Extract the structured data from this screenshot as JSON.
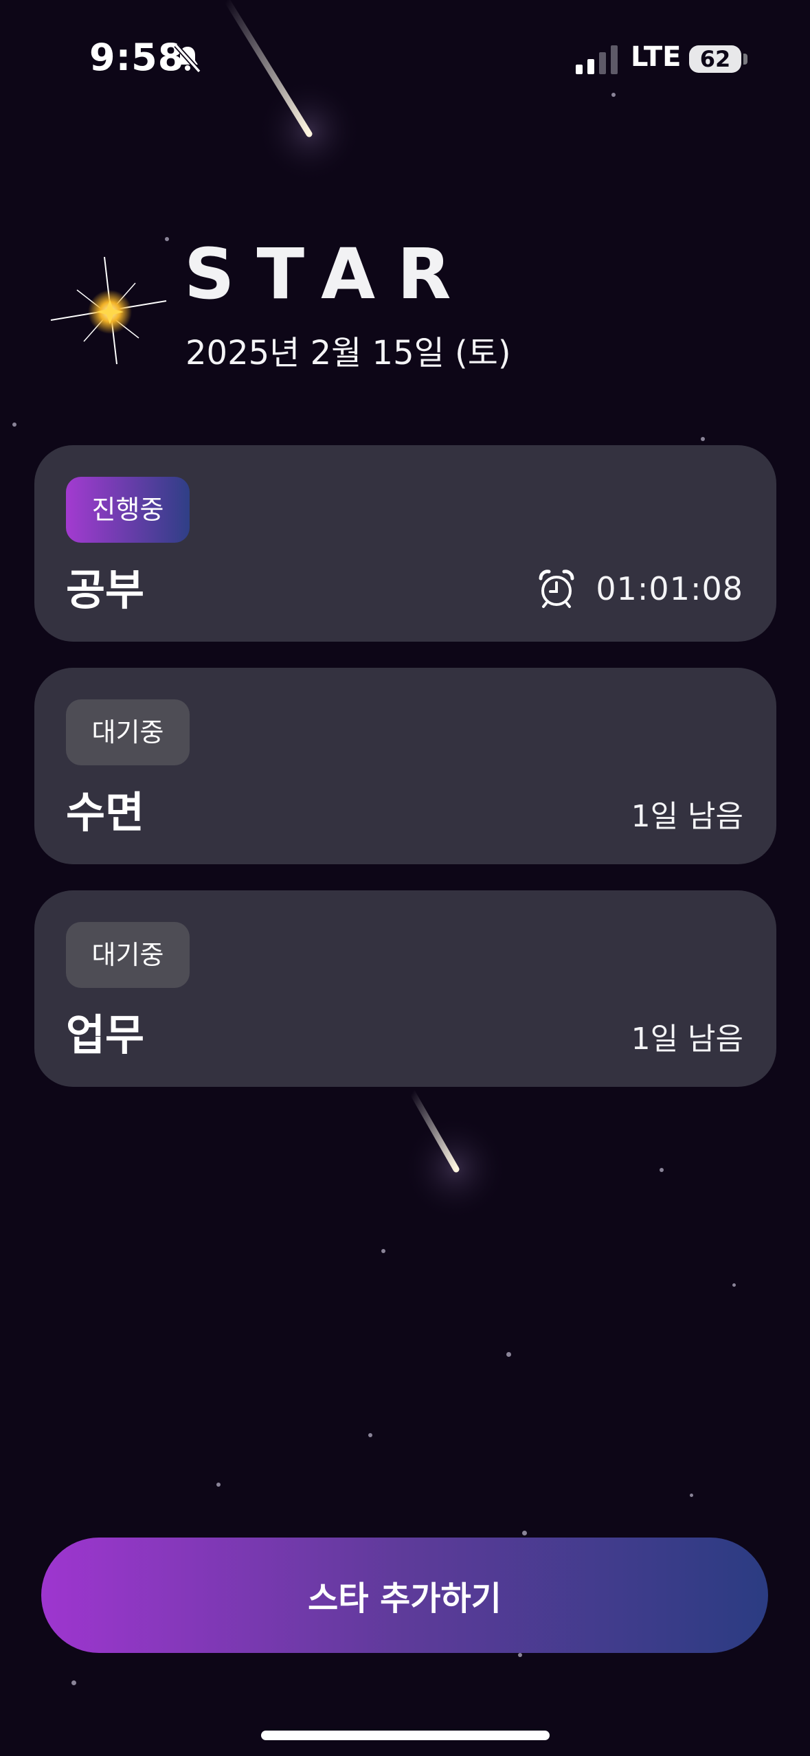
{
  "status_bar": {
    "time": "9:58",
    "network": "LTE",
    "battery": "62"
  },
  "header": {
    "title": "STAR",
    "date": "2025년 2월 15일 (토)"
  },
  "stars": [
    {
      "status": "진행중",
      "name": "공부",
      "right_text": "01:01:08"
    },
    {
      "status": "대기중",
      "name": "수면",
      "right_text": "1일 남음"
    },
    {
      "status": "대기중",
      "name": "업무",
      "right_text": "1일 남음"
    }
  ],
  "add_button": {
    "label": "스타 추가하기"
  },
  "colors": {
    "background": "#0d0617",
    "card": "#343240",
    "active_badge_start": "#a33bd0",
    "active_badge_end": "#2f3f86",
    "waiting_badge": "#4e4d55"
  }
}
